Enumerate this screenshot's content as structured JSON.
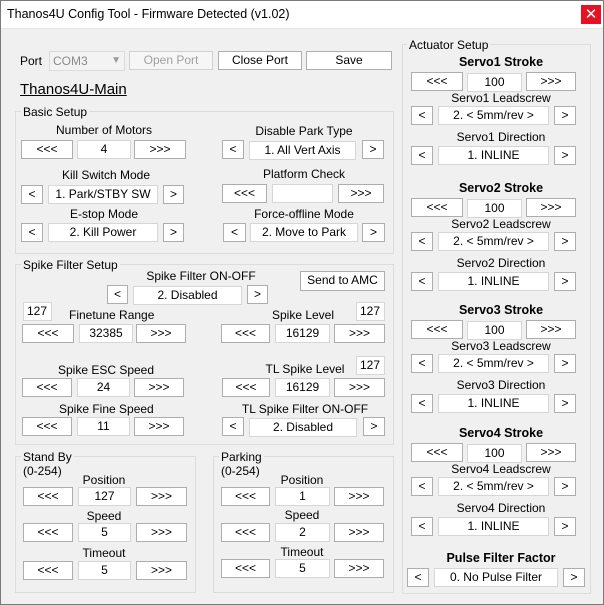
{
  "window": {
    "title": "Thanos4U Config Tool - Firmware Detected (v1.02)",
    "close_glyph": "✕"
  },
  "port": {
    "label": "Port",
    "value": "COM3",
    "open_label": "Open Port",
    "close_label": "Close Port",
    "save_label": "Save"
  },
  "profile": {
    "name": "Thanos4U-Main"
  },
  "prev": "<<<",
  "next": ">>>",
  "left": "<",
  "right": ">",
  "basic": {
    "title": "Basic Setup",
    "motors": {
      "label": "Number of Motors",
      "value": "4"
    },
    "park": {
      "label": "Disable Park Type",
      "value": "1. All Vert Axis"
    },
    "kill": {
      "label": "Kill Switch Mode",
      "value": "1. Park/STBY SW"
    },
    "platform": {
      "label": "Platform Check",
      "value": ""
    },
    "estop": {
      "label": "E-stop Mode",
      "value": "2. Kill Power"
    },
    "offline": {
      "label": "Force-offline Mode",
      "value": "2. Move to Park"
    }
  },
  "spike": {
    "title": "Spike Filter Setup",
    "onoff": {
      "label": "Spike Filter ON-OFF",
      "value": "2. Disabled"
    },
    "send_label": "Send to AMC",
    "finetune": {
      "label": "Finetune Range",
      "value": "32385",
      "side": "127"
    },
    "level": {
      "label": "Spike Level",
      "value": "16129",
      "side": "127"
    },
    "esc": {
      "label": "Spike ESC Speed",
      "value": "24"
    },
    "tl_level": {
      "label": "TL Spike Level",
      "value": "16129",
      "side": "127"
    },
    "fine": {
      "label": "Spike Fine Speed",
      "value": "11"
    },
    "tl_onoff": {
      "label": "TL Spike Filter ON-OFF",
      "value": "2. Disabled"
    }
  },
  "standby": {
    "title": "Stand By",
    "range": "(0-254)",
    "pos_label": "Position",
    "pos": "127",
    "speed_label": "Speed",
    "speed": "5",
    "timeout_label": "Timeout",
    "timeout": "5"
  },
  "parking": {
    "title": "Parking",
    "range": "(0-254)",
    "pos_label": "Position",
    "pos": "1",
    "speed_label": "Speed",
    "speed": "2",
    "timeout_label": "Timeout",
    "timeout": "5"
  },
  "actuator": {
    "title": "Actuator Setup",
    "servos": [
      {
        "stroke_label": "Servo1 Stroke",
        "stroke": "100",
        "lead_label": "Servo1 Leadscrew",
        "lead": "2. < 5mm/rev >",
        "dir_label": "Servo1 Direction",
        "dir": "1. INLINE"
      },
      {
        "stroke_label": "Servo2 Stroke",
        "stroke": "100",
        "lead_label": "Servo2 Leadscrew",
        "lead": "2. < 5mm/rev >",
        "dir_label": "Servo2 Direction",
        "dir": "1. INLINE"
      },
      {
        "stroke_label": "Servo3 Stroke",
        "stroke": "100",
        "lead_label": "Servo3 Leadscrew",
        "lead": "2. < 5mm/rev >",
        "dir_label": "Servo3 Direction",
        "dir": "1. INLINE"
      },
      {
        "stroke_label": "Servo4 Stroke",
        "stroke": "100",
        "lead_label": "Servo4 Leadscrew",
        "lead": "2. < 5mm/rev >",
        "dir_label": "Servo4 Direction",
        "dir": "1. INLINE"
      }
    ],
    "pulse": {
      "label": "Pulse Filter Factor",
      "value": "0. No Pulse Filter"
    }
  }
}
